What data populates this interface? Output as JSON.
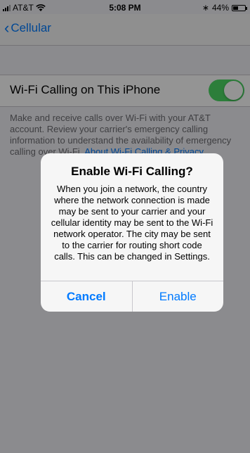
{
  "status_bar": {
    "carrier": "AT&T",
    "time": "5:08 PM",
    "battery": "44%",
    "battery_level": 0.44,
    "icons": [
      "signal-icon",
      "wifi-icon",
      "bluetooth-icon",
      "battery-icon"
    ]
  },
  "nav": {
    "back_label": "Cellular"
  },
  "settings": {
    "row_label": "Wi-Fi Calling on This iPhone",
    "toggle_on": true,
    "footer": "Make and receive calls over Wi-Fi with your AT&T account. Review your carrier's emergency calling information to understand the availability of emergency calling over Wi-Fi.",
    "footer_link": "About Wi-Fi Calling & Privacy…"
  },
  "alert": {
    "title": "Enable Wi-Fi Calling?",
    "message": "When you join a network, the country where the network connection is made may be sent to your carrier and your cellular identity may be sent to the Wi-Fi network operator. The city may be sent to the carrier for routing short code calls. This can be changed in Settings.",
    "cancel_label": "Cancel",
    "enable_label": "Enable"
  },
  "colors": {
    "accent": "#007aff",
    "toggle_on": "#4cd964",
    "background": "#efeff4"
  }
}
